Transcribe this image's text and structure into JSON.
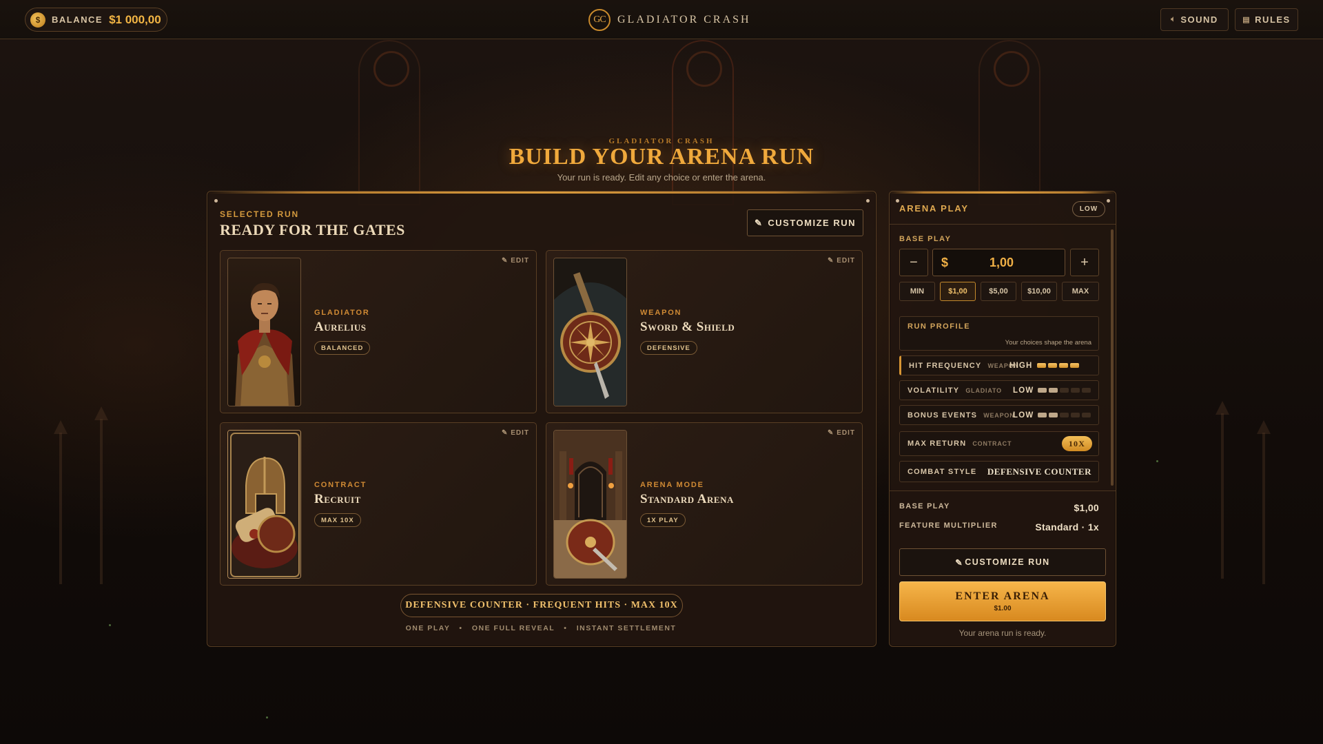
{
  "topbar": {
    "balance_label": "BALANCE",
    "balance_value": "$1 000,00",
    "brand_logo": "GC",
    "brand_name": "GLADIATOR CRASH",
    "sound_label": "SOUND",
    "rules_label": "RULES",
    "icons": {
      "coin": "coin-icon",
      "sound": "speaker-icon",
      "rules": "book-icon"
    }
  },
  "header": {
    "eyebrow": "GLADIATOR CRASH",
    "title": "BUILD YOUR ARENA RUN",
    "subtitle": "Your run is ready. Edit any choice or enter the arena."
  },
  "selected_run": {
    "eyebrow": "SELECTED RUN",
    "title": "READY FOR THE GATES",
    "customize_label": "CUSTOMIZE RUN",
    "cards": [
      {
        "category": "GLADIATOR",
        "name": "Aurelius",
        "tag": "BALANCED",
        "edit": "EDIT"
      },
      {
        "category": "WEAPON",
        "name": "Sword & Shield",
        "tag": "DEFENSIVE",
        "edit": "EDIT"
      },
      {
        "category": "CONTRACT",
        "name": "Recruit",
        "tag": "MAX 10X",
        "edit": "EDIT"
      },
      {
        "category": "ARENA MODE",
        "name": "Standard Arena",
        "tag": "1X PLAY",
        "edit": "EDIT"
      }
    ],
    "summary": "DEFENSIVE COUNTER · FREQUENT HITS · MAX 10X",
    "footnotes": [
      "ONE PLAY",
      "ONE FULL REVEAL",
      "INSTANT SETTLEMENT"
    ]
  },
  "arena_play": {
    "title": "ARENA PLAY",
    "risk_badge": "LOW",
    "base_play_label": "BASE PLAY",
    "currency": "$",
    "amount": "1,00",
    "minus": "−",
    "plus": "+",
    "chips": [
      "MIN",
      "$1,00",
      "$5,00",
      "$10,00",
      "MAX"
    ],
    "active_chip": "$1,00",
    "run_profile": {
      "title": "RUN PROFILE",
      "note": "Your choices shape the arena"
    },
    "stats": [
      {
        "label": "HIT FREQUENCY",
        "source": "WEAPON",
        "level": "HIGH",
        "bars_on": 4,
        "bars_total": 4
      },
      {
        "label": "VOLATILITY",
        "source": "GLADIATOR",
        "level": "LOW",
        "bars_on": 2,
        "bars_total": 5
      },
      {
        "label": "BONUS EVENTS",
        "source": "WEAPON",
        "level": "LOW",
        "bars_on": 2,
        "bars_total": 5
      }
    ],
    "max_return": {
      "label": "MAX RETURN",
      "source": "CONTRACT",
      "value": "10X"
    },
    "combat_style": {
      "label": "COMBAT STYLE",
      "value": "DEFENSIVE COUNTER"
    },
    "base_play_row": {
      "label": "BASE PLAY",
      "value": "$1,00"
    },
    "multiplier_row": {
      "label": "FEATURE MULTIPLIER",
      "value": "Standard · 1x"
    },
    "customize_label": "CUSTOMIZE RUN",
    "enter_label": "ENTER ARENA",
    "enter_price": "$1.00",
    "ready_text": "Your arena run is ready."
  },
  "colors": {
    "accent": "#f0a93c",
    "gold_button": "#e79a2f",
    "panel_border": "#5a3f24",
    "bg": "#140e0a"
  }
}
